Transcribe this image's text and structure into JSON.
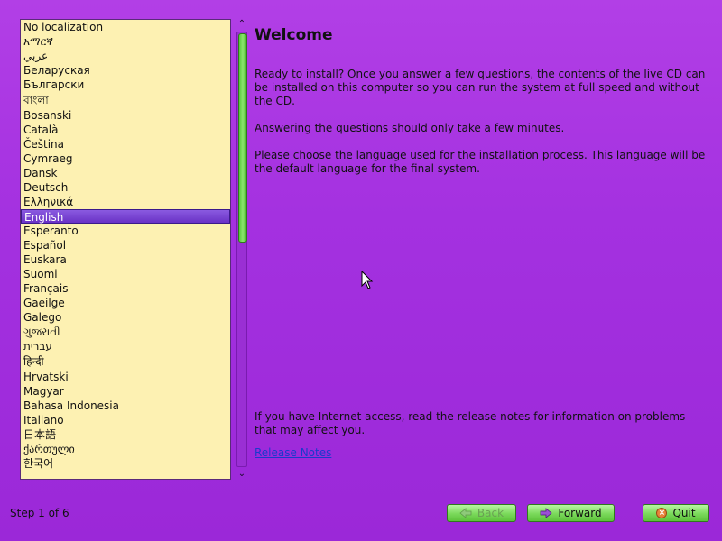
{
  "languages": [
    "No localization",
    "አማርኛ",
    "عربي",
    "Беларуская",
    "Български",
    "বাংলা",
    "Bosanski",
    "Català",
    "Čeština",
    "Cymraeg",
    "Dansk",
    "Deutsch",
    "Ελληνικά",
    "English",
    "Esperanto",
    "Español",
    "Euskara",
    "Suomi",
    "Français",
    "Gaeilge",
    "Galego",
    "ગુજરાતી",
    "עברית",
    "हिन्दी",
    "Hrvatski",
    "Magyar",
    "Bahasa Indonesia",
    "Italiano",
    "日本語",
    "ქართული",
    "한국어"
  ],
  "selected_language": "English",
  "scrollbar": {
    "up_icon": "chevron-up-icon",
    "down_icon": "chevron-down-icon"
  },
  "main": {
    "title": "Welcome",
    "paragraph1": "Ready to install? Once you answer a few questions, the contents of the live CD can be installed on this computer so you can run the system at full speed and without the CD.",
    "paragraph2": "Answering the questions should only take a few minutes.",
    "paragraph3": "Please choose the language used for the installation process. This language will be the default language for the final system.",
    "paragraph4": "If you have Internet access, read the release notes for information on problems that may affect you.",
    "release_notes_link": "Release Notes"
  },
  "footer": {
    "step": "Step 1 of 6",
    "back_label": "Back",
    "forward_label": "Forward",
    "quit_label": "Quit"
  },
  "colors": {
    "background": "#a431e0",
    "list_background": "#fdf1b2",
    "selection": "#6a32c6",
    "button_green": "#7ad95a"
  }
}
